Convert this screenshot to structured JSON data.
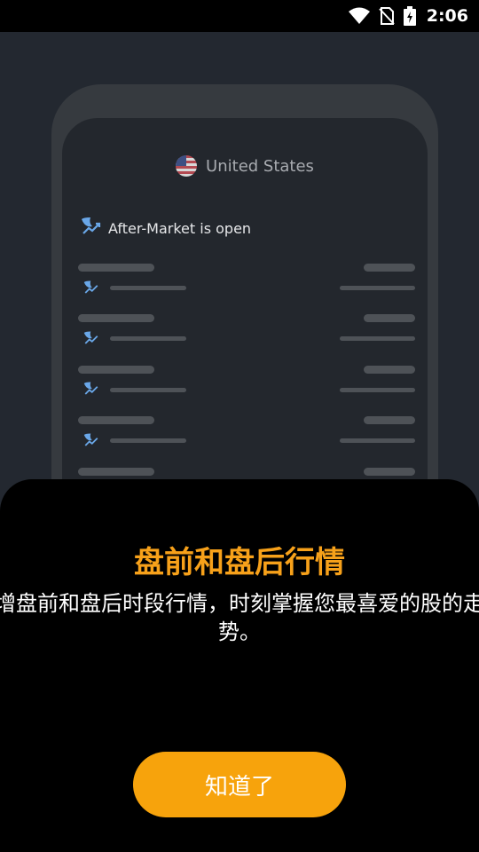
{
  "status_bar": {
    "time": "2:06",
    "icons": [
      "wifi-icon",
      "no-sim-icon",
      "battery-charging-icon"
    ]
  },
  "preview": {
    "region": "United States",
    "market_status": "After-Market is open"
  },
  "sheet": {
    "title": "盘前和盘后行情",
    "description": "增盘前和盘后时段行情，时刻掌握您最喜爱的股的走势。",
    "button_label": "知道了"
  },
  "colors": {
    "accent": "#f7a30c",
    "title": "#f7a11a",
    "sheet_bg": "#000000",
    "backdrop": "#232830"
  }
}
